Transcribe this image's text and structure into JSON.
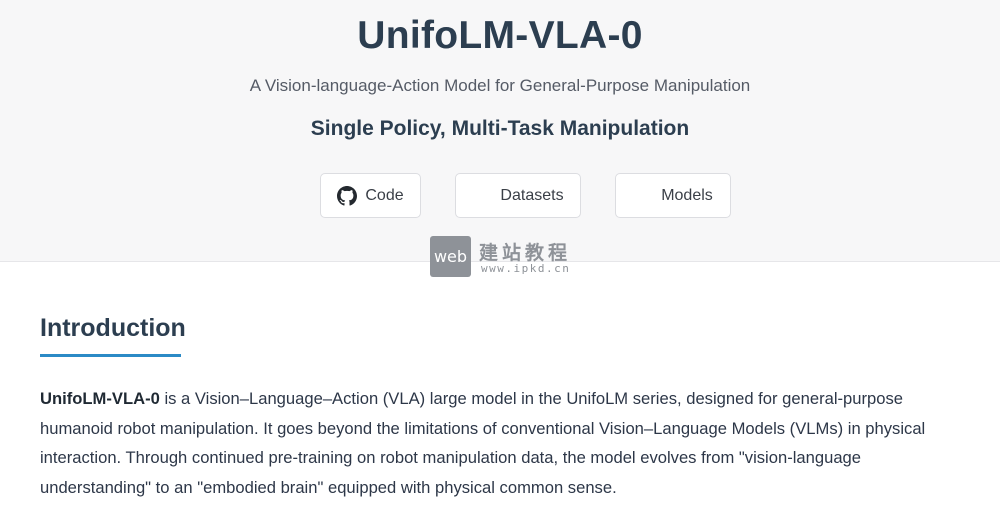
{
  "hero": {
    "title": "UnifoLM-VLA-0",
    "subtitle": "A Vision-language-Action Model for General-Purpose Manipulation",
    "tagline": "Single Policy, Multi-Task Manipulation",
    "buttons": [
      {
        "label": "Code",
        "icon": "github-icon"
      },
      {
        "label": "Datasets"
      },
      {
        "label": "Models"
      }
    ]
  },
  "watermark": {
    "badge": "web",
    "chinese_text": "建站教程",
    "url": "www.ipkd.cn"
  },
  "introduction": {
    "heading": "Introduction",
    "model_name": "UnifoLM-VLA-0",
    "body": " is a Vision–Language–Action (VLA) large model in the UnifoLM series, designed for general-purpose humanoid robot manipulation. It goes beyond the limitations of conventional Vision–Language Models (VLMs) in physical interaction. Through continued pre-training on robot manipulation data, the model evolves from \"vision-language understanding\" to an \"embodied brain\" equipped with physical common sense."
  },
  "colors": {
    "hero_background": "#f7f7f8",
    "heading": "#2c3e50",
    "accent_underline": "#2b8ac6"
  }
}
